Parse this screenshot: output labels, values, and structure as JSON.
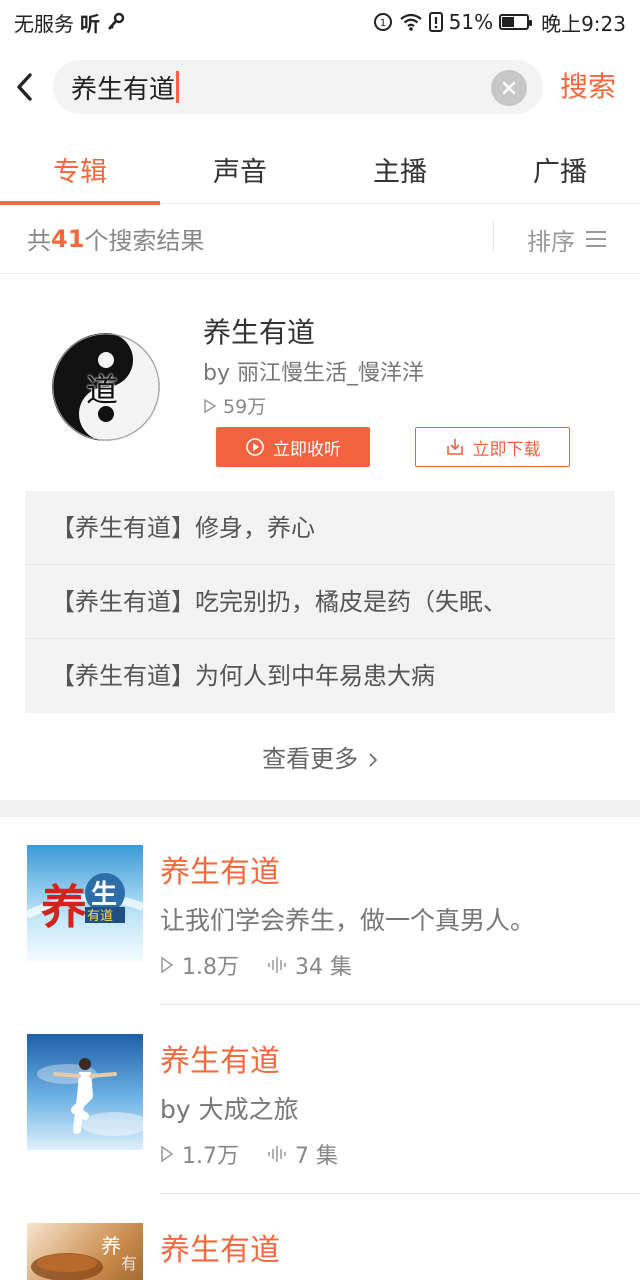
{
  "status_bar": {
    "carrier": "无服务",
    "app_mark": "听",
    "battery": "51%",
    "battery_level": 0.51,
    "time": "晚上9:23"
  },
  "search": {
    "query": "养生有道",
    "submit_label": "搜索"
  },
  "tabs": [
    {
      "label": "专辑",
      "active": true
    },
    {
      "label": "声音",
      "active": false
    },
    {
      "label": "主播",
      "active": false
    },
    {
      "label": "广播",
      "active": false
    }
  ],
  "results": {
    "prefix": "共",
    "count": "41",
    "suffix": "个搜索结果",
    "sort_label": "排序"
  },
  "featured": {
    "title": "养生有道",
    "author": "by 丽江慢生活_慢洋洋",
    "plays": "59万",
    "cover_char": "道",
    "listen_label": "立即收听",
    "download_label": "立即下载",
    "tracks": [
      "【养生有道】修身，养心",
      "【养生有道】吃完别扔，橘皮是药（失眠、",
      "【养生有道】为何人到中年易患大病"
    ],
    "see_more": "查看更多"
  },
  "albums": [
    {
      "title": "养生有道",
      "subtitle": "让我们学会养生，做一个真男人。",
      "plays": "1.8万",
      "episodes": "34 集"
    },
    {
      "title": "养生有道",
      "subtitle": "by 大成之旅",
      "plays": "1.7万",
      "episodes": "7 集"
    },
    {
      "title": "养生有道",
      "subtitle": "",
      "plays": "",
      "episodes": ""
    }
  ],
  "colors": {
    "accent": "#f5683d",
    "listen_button": "#f1623f"
  }
}
